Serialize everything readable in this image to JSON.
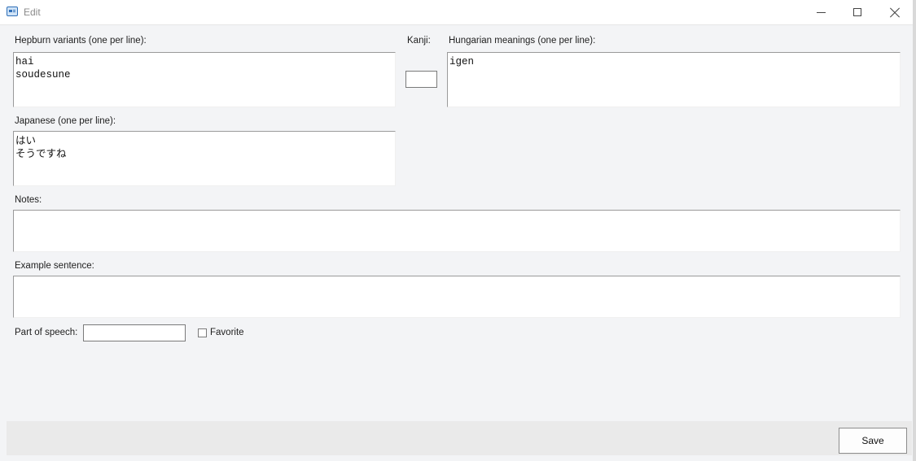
{
  "window": {
    "title": "Edit",
    "icon": "app-window-icon"
  },
  "form": {
    "hepburn": {
      "label": "Hepburn variants (one per line):",
      "value": "hai\nsoudesune"
    },
    "kanji": {
      "label": "Kanji:",
      "value": ""
    },
    "hungarian": {
      "label": "Hungarian meanings (one per line):",
      "value": "igen"
    },
    "japanese": {
      "label": "Japanese (one per line):",
      "value": "はい\nそうですね"
    },
    "notes": {
      "label": "Notes:",
      "value": ""
    },
    "example": {
      "label": "Example sentence:",
      "value": ""
    },
    "part_of_speech": {
      "label": "Part of speech:",
      "value": ""
    },
    "favorite": {
      "label": "Favorite",
      "checked": false
    }
  },
  "footer": {
    "save_label": "Save"
  }
}
